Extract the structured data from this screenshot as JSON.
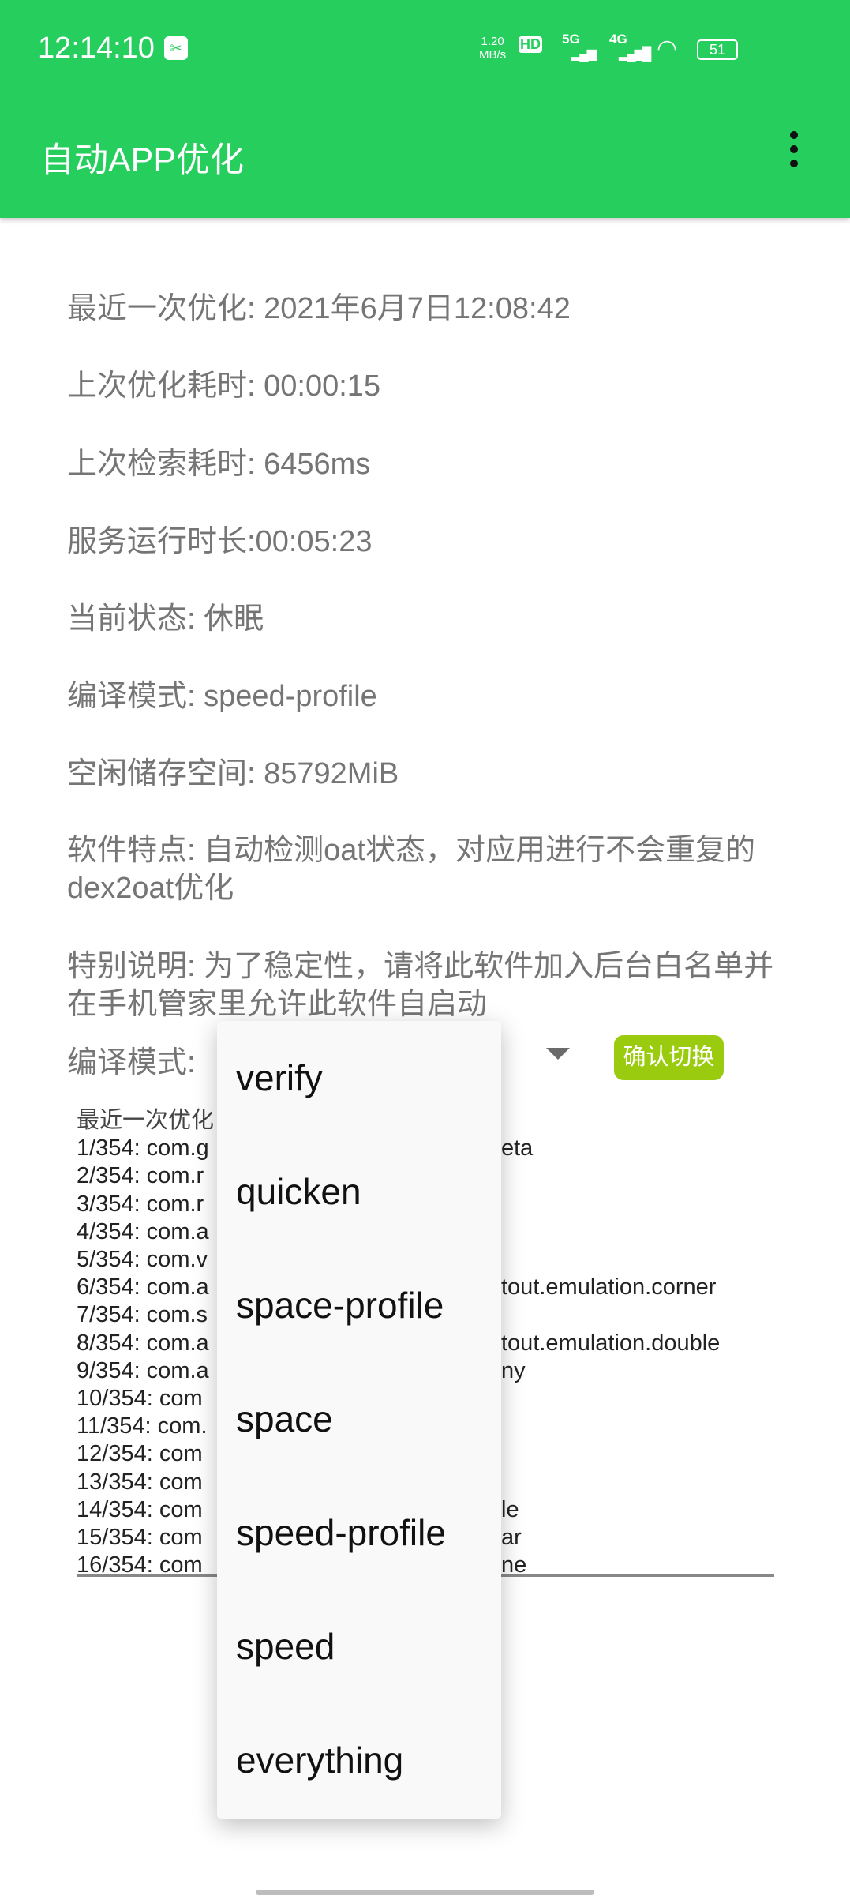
{
  "status_bar": {
    "time": "12:14:10",
    "net_rate": "1.20",
    "net_unit": "MB/s",
    "hd": "HD",
    "sim1": "5G",
    "sim2": "4G",
    "battery": "51",
    "screenshot_icon": "scissors-icon"
  },
  "app_bar": {
    "title": "自动APP优化",
    "menu_icon": "more-vert-icon"
  },
  "colors": {
    "primary": "#26CE5E",
    "button": "#9BCB0F"
  },
  "info": [
    "最近一次优化: 2021年6月7日12:08:42",
    "上次优化耗时: 00:00:15",
    "上次检索耗时: 6456ms",
    "服务运行时长:00:05:23",
    "当前状态: 休眠",
    "编译模式: speed-profile",
    "空闲储存空间: 85792MiB",
    "软件特点: 自动检测oat状态，对应用进行不会重复的dex2oat优化",
    "特别说明: 为了稳定性，请将此软件加入后台白名单并在手机管家里允许此软件自启动"
  ],
  "compile": {
    "label": "编译模式:",
    "confirm": "确认切换"
  },
  "log": {
    "header": "最近一次优化",
    "lines": [
      {
        "prefix": "1/354: com.g",
        "suffix": "eta"
      },
      {
        "prefix": "2/354: com.r",
        "suffix": ""
      },
      {
        "prefix": "3/354: com.r",
        "suffix": ""
      },
      {
        "prefix": "4/354: com.a",
        "suffix": ""
      },
      {
        "prefix": "5/354: com.v",
        "suffix": ""
      },
      {
        "prefix": "6/354: com.a",
        "suffix": "tout.emulation.corner"
      },
      {
        "prefix": "7/354: com.s",
        "suffix": ""
      },
      {
        "prefix": "8/354: com.a",
        "suffix": "tout.emulation.double"
      },
      {
        "prefix": "9/354: com.a",
        "suffix": "ny"
      },
      {
        "prefix": "10/354: com",
        "suffix": ""
      },
      {
        "prefix": "11/354: com.",
        "suffix": ""
      },
      {
        "prefix": "12/354: com",
        "suffix": ""
      },
      {
        "prefix": "13/354: com",
        "suffix": ""
      },
      {
        "prefix": "14/354: com",
        "suffix": "le"
      },
      {
        "prefix": "15/354: com",
        "suffix": "ar"
      },
      {
        "prefix": "16/354: com",
        "suffix": "ne"
      }
    ]
  },
  "dropdown": {
    "options": [
      "verify",
      "quicken",
      "space-profile",
      "space",
      "speed-profile",
      "speed",
      "everything"
    ]
  }
}
